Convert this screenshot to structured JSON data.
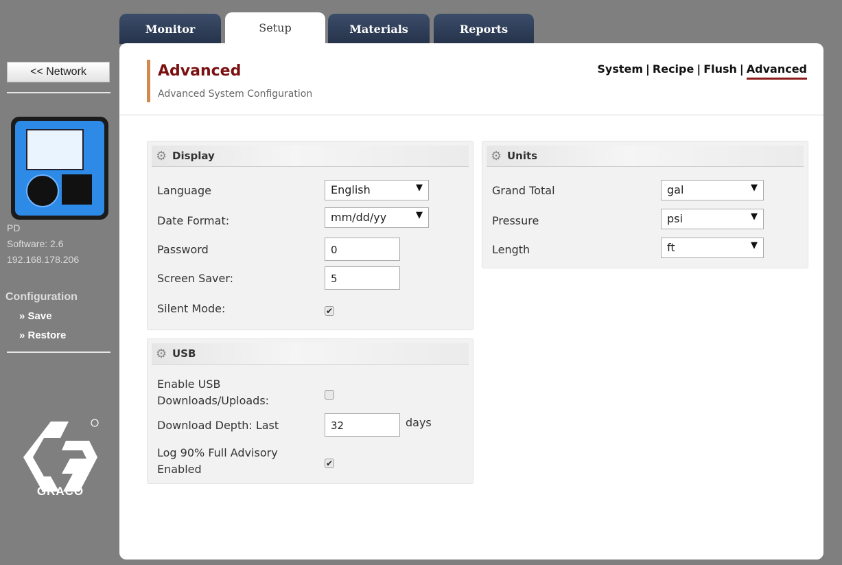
{
  "tabs": [
    {
      "label": "Monitor",
      "active": false
    },
    {
      "label": "Setup",
      "active": true
    },
    {
      "label": "Materials",
      "active": false
    },
    {
      "label": "Reports",
      "active": false
    }
  ],
  "sidebar": {
    "network_button": "<< Network",
    "device_name": "PD",
    "software": "Software: 2.6",
    "ip": "192.168.178.206",
    "configuration_title": "Configuration",
    "save_link": "» Save",
    "restore_link": "» Restore",
    "brand": "GRACO"
  },
  "header": {
    "title": "Advanced",
    "subtitle": "Advanced System Configuration",
    "nav": [
      "System",
      "Recipe",
      "Flush",
      "Advanced"
    ],
    "nav_separator": "|",
    "current": "Advanced"
  },
  "display_panel": {
    "title": "Display",
    "language_label": "Language",
    "language_value": "English",
    "date_format_label": "Date Format:",
    "date_format_value": "mm/dd/yy",
    "password_label": "Password",
    "password_value": "0",
    "screen_saver_label": "Screen Saver:",
    "screen_saver_value": "5",
    "silent_mode_label": "Silent Mode:",
    "silent_mode_checked": true
  },
  "usb_panel": {
    "title": "USB",
    "enable_label_1": "Enable USB",
    "enable_label_2": "Downloads/Uploads:",
    "enable_checked": false,
    "depth_label": "Download Depth: Last",
    "depth_value": "32",
    "depth_unit": "days",
    "log_label_1": "Log 90% Full Advisory",
    "log_label_2": "Enabled",
    "log_checked": true
  },
  "units_panel": {
    "title": "Units",
    "grand_total_label": "Grand Total",
    "grand_total_value": "gal",
    "pressure_label": "Pressure",
    "pressure_value": "psi",
    "length_label": "Length",
    "length_value": "ft"
  },
  "colors": {
    "accent_title": "#7a1010",
    "header_bar": "#d2894e",
    "tab_dark": "#2c3a55"
  },
  "icons": {
    "check": "✔",
    "dropdown": "▼",
    "gear": "⚙"
  }
}
